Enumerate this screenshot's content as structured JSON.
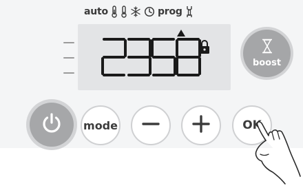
{
  "modes": {
    "auto_label": "auto",
    "prog_label": "prog",
    "icons": [
      "thermometer-comfort-icon",
      "thermometer-eco-icon",
      "snowflake-icon",
      "clock-icon",
      "wrench-icon"
    ]
  },
  "display": {
    "digits": "2358",
    "lock_icon": "padlock-icon",
    "indicator_icon": "arrow-up-triangle-icon"
  },
  "buttons": {
    "boost_label": "boost",
    "boost_icon": "hourglass-icon",
    "power_icon": "power-icon",
    "mode_label": "mode",
    "minus_icon": "minus-icon",
    "plus_icon": "plus-icon",
    "ok_label": "OK"
  },
  "colors": {
    "panel": "#f4f5f6",
    "lcd_background": "#e3e4e6",
    "segment": "#1a1a1a",
    "button_fill": "#a6a7a9",
    "button_ring": "#cfd0d2",
    "text": "#3c3c3c"
  }
}
